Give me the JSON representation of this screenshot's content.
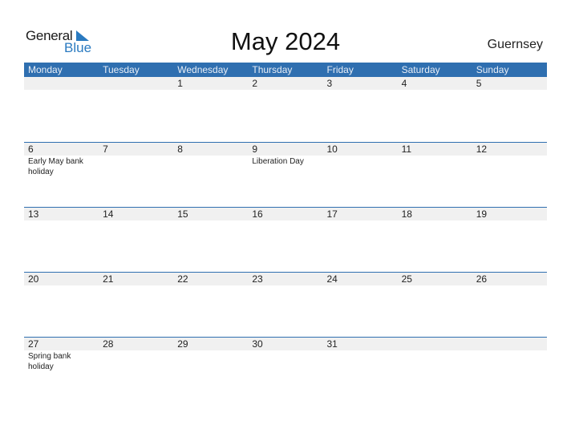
{
  "logo": {
    "line1": "General",
    "line2": "Blue",
    "accent_color": "#2a7ac0"
  },
  "title": "May 2024",
  "country": "Guernsey",
  "colors": {
    "header_bg": "#2f6fb0",
    "band_bg": "#f0f0f0"
  },
  "weekdays": [
    "Monday",
    "Tuesday",
    "Wednesday",
    "Thursday",
    "Friday",
    "Saturday",
    "Sunday"
  ],
  "weeks": [
    [
      {
        "day": "",
        "holiday": ""
      },
      {
        "day": "",
        "holiday": ""
      },
      {
        "day": "1",
        "holiday": ""
      },
      {
        "day": "2",
        "holiday": ""
      },
      {
        "day": "3",
        "holiday": ""
      },
      {
        "day": "4",
        "holiday": ""
      },
      {
        "day": "5",
        "holiday": ""
      }
    ],
    [
      {
        "day": "6",
        "holiday": "Early May bank holiday"
      },
      {
        "day": "7",
        "holiday": ""
      },
      {
        "day": "8",
        "holiday": ""
      },
      {
        "day": "9",
        "holiday": "Liberation Day"
      },
      {
        "day": "10",
        "holiday": ""
      },
      {
        "day": "11",
        "holiday": ""
      },
      {
        "day": "12",
        "holiday": ""
      }
    ],
    [
      {
        "day": "13",
        "holiday": ""
      },
      {
        "day": "14",
        "holiday": ""
      },
      {
        "day": "15",
        "holiday": ""
      },
      {
        "day": "16",
        "holiday": ""
      },
      {
        "day": "17",
        "holiday": ""
      },
      {
        "day": "18",
        "holiday": ""
      },
      {
        "day": "19",
        "holiday": ""
      }
    ],
    [
      {
        "day": "20",
        "holiday": ""
      },
      {
        "day": "21",
        "holiday": ""
      },
      {
        "day": "22",
        "holiday": ""
      },
      {
        "day": "23",
        "holiday": ""
      },
      {
        "day": "24",
        "holiday": ""
      },
      {
        "day": "25",
        "holiday": ""
      },
      {
        "day": "26",
        "holiday": ""
      }
    ],
    [
      {
        "day": "27",
        "holiday": "Spring bank holiday"
      },
      {
        "day": "28",
        "holiday": ""
      },
      {
        "day": "29",
        "holiday": ""
      },
      {
        "day": "30",
        "holiday": ""
      },
      {
        "day": "31",
        "holiday": ""
      },
      {
        "day": "",
        "holiday": ""
      },
      {
        "day": "",
        "holiday": ""
      }
    ]
  ]
}
